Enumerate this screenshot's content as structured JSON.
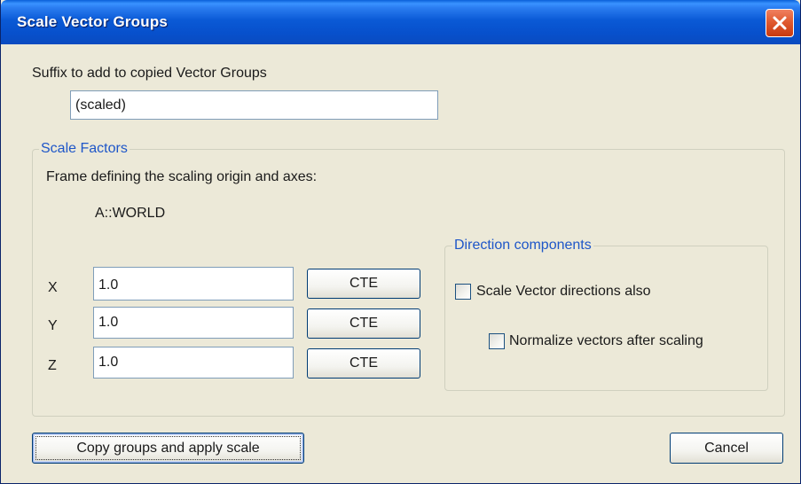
{
  "window": {
    "title": "Scale Vector Groups"
  },
  "suffix": {
    "label": "Suffix to add to copied Vector Groups",
    "value": "(scaled)"
  },
  "scale_factors": {
    "title": "Scale Factors",
    "frame_label": "Frame defining the scaling origin and axes:",
    "frame_value": "A::WORLD",
    "x": {
      "label": "X",
      "value": "1.0",
      "button": "CTE"
    },
    "y": {
      "label": "Y",
      "value": "1.0",
      "button": "CTE"
    },
    "z": {
      "label": "Z",
      "value": "1.0",
      "button": "CTE"
    }
  },
  "direction_components": {
    "title": "Direction components",
    "scale_directions": {
      "label": "Scale Vector directions also",
      "checked": false
    },
    "normalize": {
      "label": "Normalize vectors after scaling",
      "checked": false
    }
  },
  "buttons": {
    "apply": "Copy groups and apply scale",
    "cancel": "Cancel"
  },
  "icons": {
    "close": "close-icon"
  },
  "colors": {
    "titlebar": "#0a5ad6",
    "close": "#e05a30",
    "group_title": "#1e56c8",
    "dialog_bg": "#ece9d8"
  }
}
